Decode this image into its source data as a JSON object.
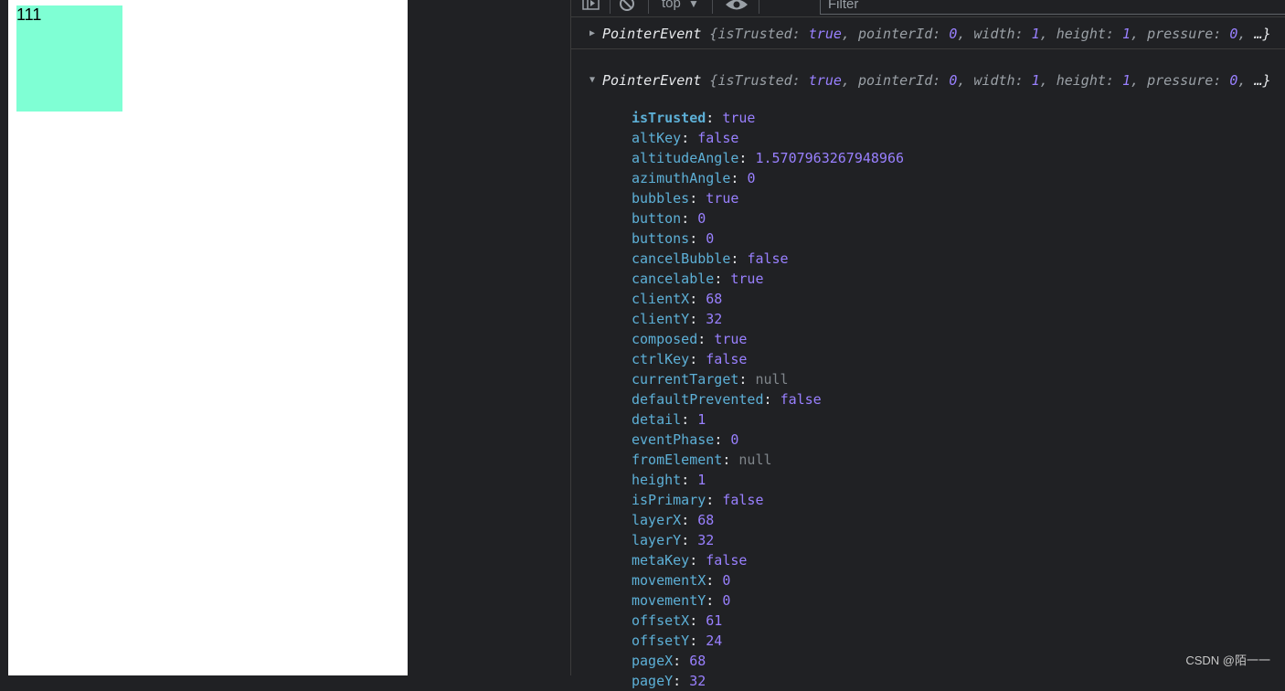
{
  "page": {
    "box_text": "111",
    "box_color": "#7fffd4"
  },
  "toolbar": {
    "context": "top",
    "context_arrow": "▼",
    "filter_placeholder": "Filter"
  },
  "logs": {
    "collapsed": {
      "class_name": "PointerEvent",
      "preview": [
        {
          "k": "isTrusted",
          "v": "true"
        },
        {
          "k": "pointerId",
          "v": "0"
        },
        {
          "k": "width",
          "v": "1"
        },
        {
          "k": "height",
          "v": "1"
        },
        {
          "k": "pressure",
          "v": "0"
        }
      ],
      "ellipsis": "…}"
    },
    "expanded": {
      "class_name": "PointerEvent",
      "preview": [
        {
          "k": "isTrusted",
          "v": "true"
        },
        {
          "k": "pointerId",
          "v": "0"
        },
        {
          "k": "width",
          "v": "1"
        },
        {
          "k": "height",
          "v": "1"
        },
        {
          "k": "pressure",
          "v": "0"
        }
      ],
      "ellipsis": "…}",
      "properties": [
        {
          "key": "isTrusted",
          "value": "true",
          "type": "bool",
          "own": true
        },
        {
          "key": "altKey",
          "value": "false",
          "type": "bool"
        },
        {
          "key": "altitudeAngle",
          "value": "1.5707963267948966",
          "type": "num"
        },
        {
          "key": "azimuthAngle",
          "value": "0",
          "type": "num"
        },
        {
          "key": "bubbles",
          "value": "true",
          "type": "bool"
        },
        {
          "key": "button",
          "value": "0",
          "type": "num"
        },
        {
          "key": "buttons",
          "value": "0",
          "type": "num"
        },
        {
          "key": "cancelBubble",
          "value": "false",
          "type": "bool"
        },
        {
          "key": "cancelable",
          "value": "true",
          "type": "bool"
        },
        {
          "key": "clientX",
          "value": "68",
          "type": "num"
        },
        {
          "key": "clientY",
          "value": "32",
          "type": "num"
        },
        {
          "key": "composed",
          "value": "true",
          "type": "bool"
        },
        {
          "key": "ctrlKey",
          "value": "false",
          "type": "bool"
        },
        {
          "key": "currentTarget",
          "value": "null",
          "type": "null"
        },
        {
          "key": "defaultPrevented",
          "value": "false",
          "type": "bool"
        },
        {
          "key": "detail",
          "value": "1",
          "type": "num"
        },
        {
          "key": "eventPhase",
          "value": "0",
          "type": "num"
        },
        {
          "key": "fromElement",
          "value": "null",
          "type": "null"
        },
        {
          "key": "height",
          "value": "1",
          "type": "num"
        },
        {
          "key": "isPrimary",
          "value": "false",
          "type": "bool"
        },
        {
          "key": "layerX",
          "value": "68",
          "type": "num"
        },
        {
          "key": "layerY",
          "value": "32",
          "type": "num"
        },
        {
          "key": "metaKey",
          "value": "false",
          "type": "bool"
        },
        {
          "key": "movementX",
          "value": "0",
          "type": "num"
        },
        {
          "key": "movementY",
          "value": "0",
          "type": "num"
        },
        {
          "key": "offsetX",
          "value": "61",
          "type": "num"
        },
        {
          "key": "offsetY",
          "value": "24",
          "type": "num"
        },
        {
          "key": "pageX",
          "value": "68",
          "type": "num"
        },
        {
          "key": "pageY",
          "value": "32",
          "type": "num"
        }
      ]
    }
  },
  "watermark": "CSDN @陌一一"
}
